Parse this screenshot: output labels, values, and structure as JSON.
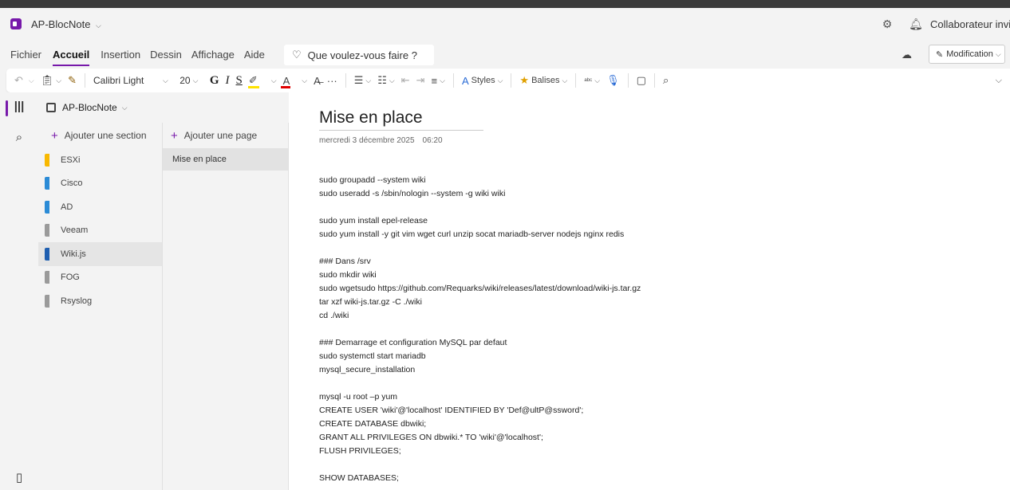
{
  "window": {
    "notebook_title": "AP-BlocNote",
    "collaborator": "Collaborateur invit"
  },
  "menu": {
    "tabs": [
      "Fichier",
      "Accueil",
      "Insertion",
      "Dessin",
      "Affichage",
      "Aide"
    ],
    "search_placeholder": "Que voulez-vous faire ?",
    "mode_label": "Modification"
  },
  "ribbon": {
    "font_name": "Calibri Light",
    "font_size": "20",
    "styles_label": "Styles",
    "tags_label": "Balises"
  },
  "notebook": {
    "name": "AP-BlocNote",
    "add_section": "Ajouter une section",
    "add_page": "Ajouter une page",
    "sections": [
      {
        "name": "ESXi",
        "color": "#f8b800"
      },
      {
        "name": "Cisco",
        "color": "#2b8bd6"
      },
      {
        "name": "AD",
        "color": "#2b8bd6"
      },
      {
        "name": "Veeam",
        "color": "#9a9a9a"
      },
      {
        "name": "Wiki.js",
        "color": "#1f5fb0"
      },
      {
        "name": "FOG",
        "color": "#9a9a9a"
      },
      {
        "name": "Rsyslog",
        "color": "#9a9a9a"
      }
    ],
    "selected_section": 4,
    "pages": [
      {
        "title": "Mise en place"
      }
    ]
  },
  "page": {
    "title": "Mise en place",
    "date": "mercredi 3 décembre 2025",
    "time": "06:20",
    "lines": [
      "sudo groupadd --system wiki",
      "sudo useradd -s /sbin/nologin --system -g wiki wiki",
      "",
      "sudo yum install epel-release",
      "sudo yum install -y git vim wget curl unzip socat mariadb-server nodejs nginx redis",
      "",
      "### Dans /srv",
      "sudo mkdir wiki",
      "sudo wgetsudo https://github.com/Requarks/wiki/releases/latest/download/wiki-js.tar.gz",
      "tar xzf wiki-js.tar.gz -C ./wiki",
      "cd ./wiki",
      "",
      "### Demarrage et configuration MySQL par defaut",
      "sudo systemctl start mariadb",
      "mysql_secure_installation",
      "",
      "mysql -u root –p yum",
      "CREATE USER 'wiki'@'localhost' IDENTIFIED BY 'Def@ultP@ssword';",
      "CREATE DATABASE dbwiki;",
      "GRANT ALL PRIVILEGES ON dbwiki.* TO 'wiki'@'localhost';",
      "FLUSH PRIVILEGES;",
      "",
      "SHOW DATABASES;"
    ]
  },
  "colors": {
    "accent": "#7719aa"
  }
}
